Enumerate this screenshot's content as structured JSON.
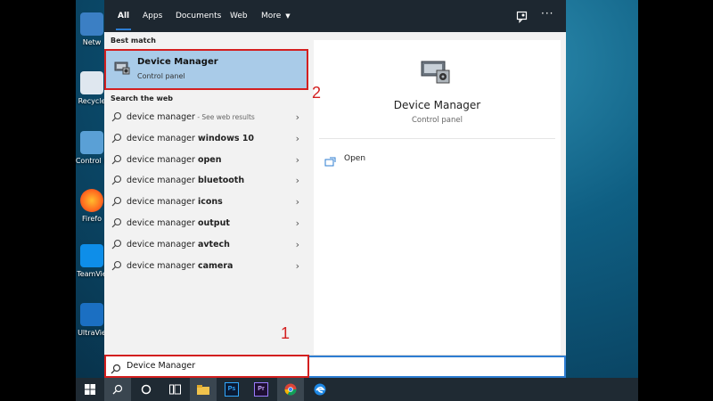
{
  "tabs": [
    {
      "label": "All",
      "active": true
    },
    {
      "label": "Apps"
    },
    {
      "label": "Documents"
    },
    {
      "label": "Web"
    },
    {
      "label": "More"
    }
  ],
  "sections": {
    "best_match": "Best match",
    "search_web": "Search the web"
  },
  "best_match": {
    "title": "Device Manager",
    "subtitle": "Control panel"
  },
  "web_results": [
    {
      "query": "device manager",
      "bold": "",
      "hint": " - See web results"
    },
    {
      "query": "device manager ",
      "bold": "windows 10",
      "hint": ""
    },
    {
      "query": "device manager ",
      "bold": "open",
      "hint": ""
    },
    {
      "query": "device manager ",
      "bold": "bluetooth",
      "hint": ""
    },
    {
      "query": "device manager ",
      "bold": "icons",
      "hint": ""
    },
    {
      "query": "device manager ",
      "bold": "output",
      "hint": ""
    },
    {
      "query": "device manager ",
      "bold": "avtech",
      "hint": ""
    },
    {
      "query": "device manager ",
      "bold": "camera",
      "hint": ""
    }
  ],
  "preview": {
    "title": "Device Manager",
    "subtitle": "Control panel",
    "action_open": "Open"
  },
  "search": {
    "value": "Device Manager"
  },
  "desktop_icons": [
    "Netw",
    "Recycle",
    "Control P",
    "Firefo",
    "TeamVie",
    "UltraVie"
  ],
  "annotations": [
    "1",
    "2"
  ],
  "colors": {
    "highlight": "#a9cbe8",
    "annotation": "#d31f1f",
    "topbar": "#1d2730",
    "accent": "#2d7dd2"
  },
  "taskbar": {
    "icons": [
      "windows-icon",
      "search-icon",
      "cortana-icon",
      "task-view-icon",
      "file-explorer-icon",
      "photoshop-icon",
      "premiere-icon",
      "chrome-icon",
      "edge-icon"
    ],
    "ps_label": "Ps",
    "pr_label": "Pr"
  }
}
